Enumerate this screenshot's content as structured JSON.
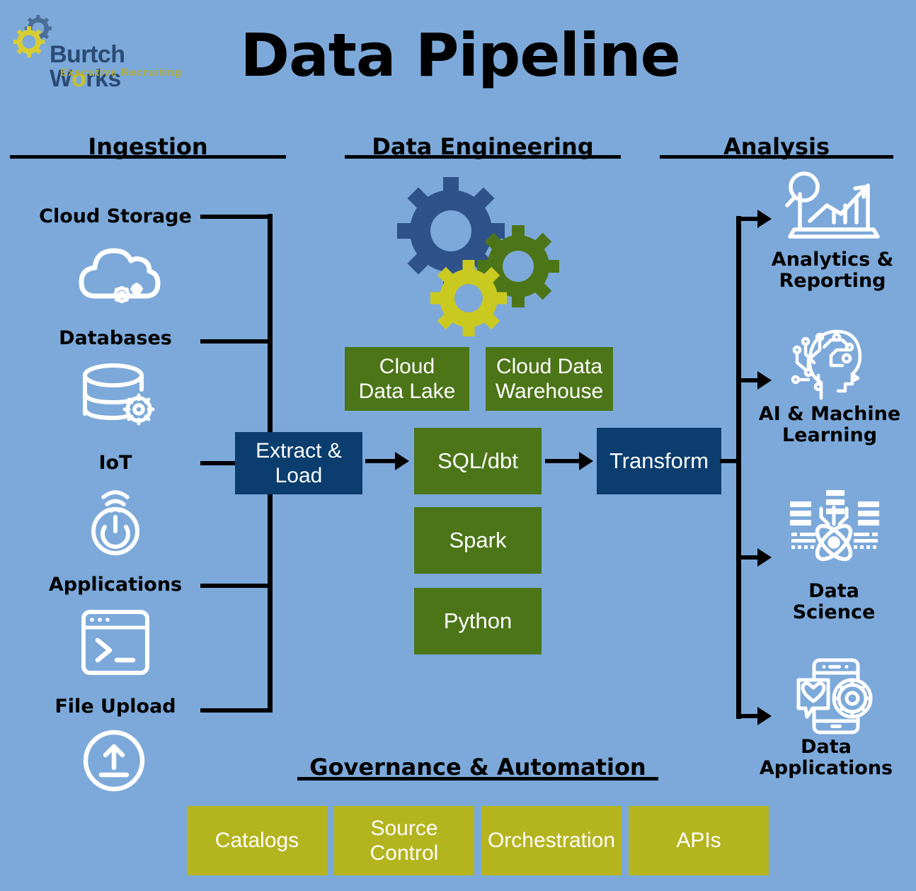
{
  "brand": {
    "name_part1": "Burtch W",
    "name_accent": "o",
    "name_part2": "rks",
    "tagline": "Executive Recruiting",
    "gear_yellow": "#d6cc33",
    "gear_blue": "#4b6d99"
  },
  "page": {
    "title": "Data Pipeline",
    "background": "#7CA9DA"
  },
  "colors": {
    "navy": "#0b3d6e",
    "green": "#4c7518",
    "olive": "#b4b41e",
    "gear_blue": "#2e5289",
    "gear_green": "#4c7518",
    "gear_yellow": "#c9c920",
    "line": "#000000",
    "icon": "#ffffff"
  },
  "sections": {
    "ingestion": {
      "title": "Ingestion"
    },
    "data_engineering": {
      "title": "Data Engineering"
    },
    "analysis": {
      "title": "Analysis"
    },
    "governance": {
      "title": "Governance & Automation"
    }
  },
  "ingestion": {
    "items": [
      {
        "label": "Cloud Storage",
        "icon": "cloud-storage-icon"
      },
      {
        "label": "Databases",
        "icon": "database-icon"
      },
      {
        "label": "IoT",
        "icon": "iot-power-icon"
      },
      {
        "label": "Applications",
        "icon": "terminal-window-icon"
      },
      {
        "label": "File Upload",
        "icon": "file-upload-icon"
      }
    ]
  },
  "pipeline": {
    "extract_load": "Extract &\nLoad",
    "extract_load_line1": "Extract &",
    "extract_load_line2": "Load",
    "transform": "Transform",
    "storage": [
      {
        "line1": "Cloud",
        "line2": "Data Lake"
      },
      {
        "line1": "Cloud Data",
        "line2": "Warehouse"
      }
    ],
    "tools": [
      {
        "label": "SQL/dbt"
      },
      {
        "label": "Spark"
      },
      {
        "label": "Python"
      }
    ]
  },
  "analysis": {
    "items": [
      {
        "line1": "Analytics &",
        "line2": "Reporting",
        "icon": "analytics-chart-icon"
      },
      {
        "line1": "AI & Machine",
        "line2": "Learning",
        "icon": "ai-brain-icon"
      },
      {
        "line1": "Data",
        "line2": "Science",
        "icon": "atom-data-icon"
      },
      {
        "line1": "Data",
        "line2": "Applications",
        "icon": "mobile-app-icon"
      }
    ]
  },
  "governance": {
    "items": [
      {
        "line1": "Catalogs",
        "line2": ""
      },
      {
        "line1": "Source",
        "line2": "Control"
      },
      {
        "line1": "Orchestration",
        "line2": ""
      },
      {
        "line1": "APIs",
        "line2": ""
      }
    ]
  }
}
